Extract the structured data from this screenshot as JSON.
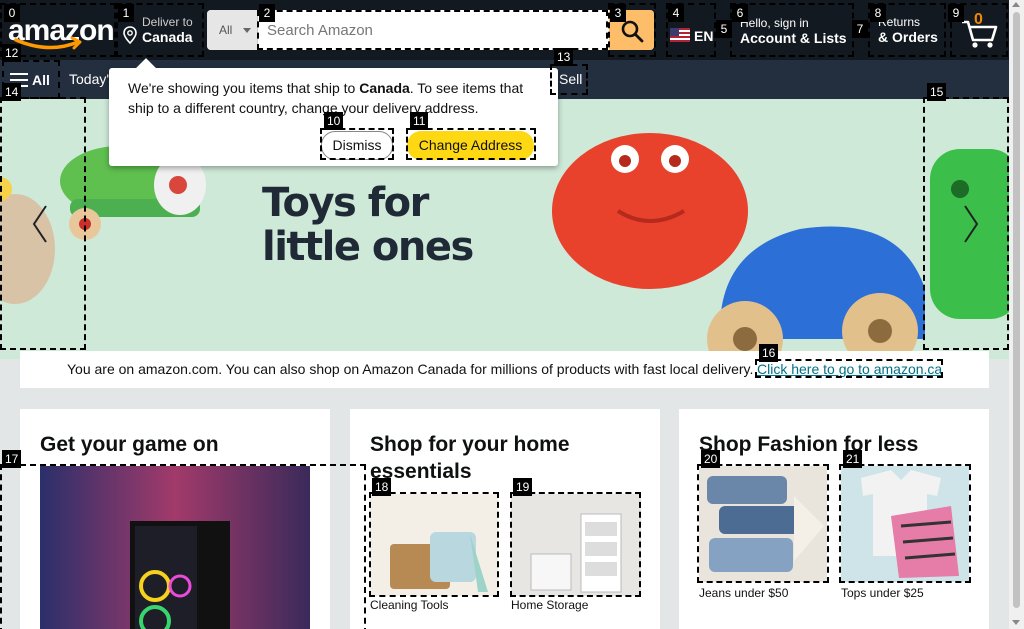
{
  "header": {
    "logo_text": "amazon",
    "deliver_line1": "Deliver to",
    "deliver_line2": "Canada",
    "search_category": "All",
    "search_placeholder": "Search Amazon",
    "language": "EN",
    "account_line1": "Hello, sign in",
    "account_line2": "Account & Lists",
    "orders_line1": "Returns",
    "orders_line2": "& Orders",
    "cart_count": "0"
  },
  "subnav": {
    "all_label": "All",
    "today_label": "Today's",
    "sell_label": "Sell"
  },
  "popover": {
    "message_pre": "We're showing you items that ship to ",
    "message_country": "Canada",
    "message_post": ". To see items that ship to a different country, change your delivery address.",
    "dismiss_label": "Dismiss",
    "change_label": "Change Address"
  },
  "hero": {
    "title_line1": "Toys for",
    "title_line2": "little ones"
  },
  "info_bar": {
    "text": "You are on amazon.com. You can also shop on Amazon Canada for millions of products with fast local delivery.",
    "link": "Click here to go to amazon.ca"
  },
  "cards": {
    "game": {
      "title": "Get your game on"
    },
    "home": {
      "title": "Shop for your home essentials",
      "tiles": [
        {
          "label": "Cleaning Tools"
        },
        {
          "label": "Home Storage"
        }
      ]
    },
    "fashion": {
      "title": "Shop Fashion for less",
      "tiles": [
        {
          "label": "Jeans under $50"
        },
        {
          "label": "Tops under $25"
        }
      ]
    }
  },
  "annotations": [
    "0",
    "1",
    "2",
    "3",
    "4",
    "5",
    "6",
    "7",
    "8",
    "9",
    "10",
    "11",
    "12",
    "13",
    "14",
    "15",
    "16",
    "17",
    "18",
    "19",
    "20",
    "21"
  ],
  "colors": {
    "nav_dark": "#131921",
    "nav_mid": "#232f3e",
    "search_button": "#febd69",
    "primary_button": "#ffd814",
    "cart_count": "#f08804",
    "link": "#007185",
    "hero_bg": "#cfe9d9"
  }
}
